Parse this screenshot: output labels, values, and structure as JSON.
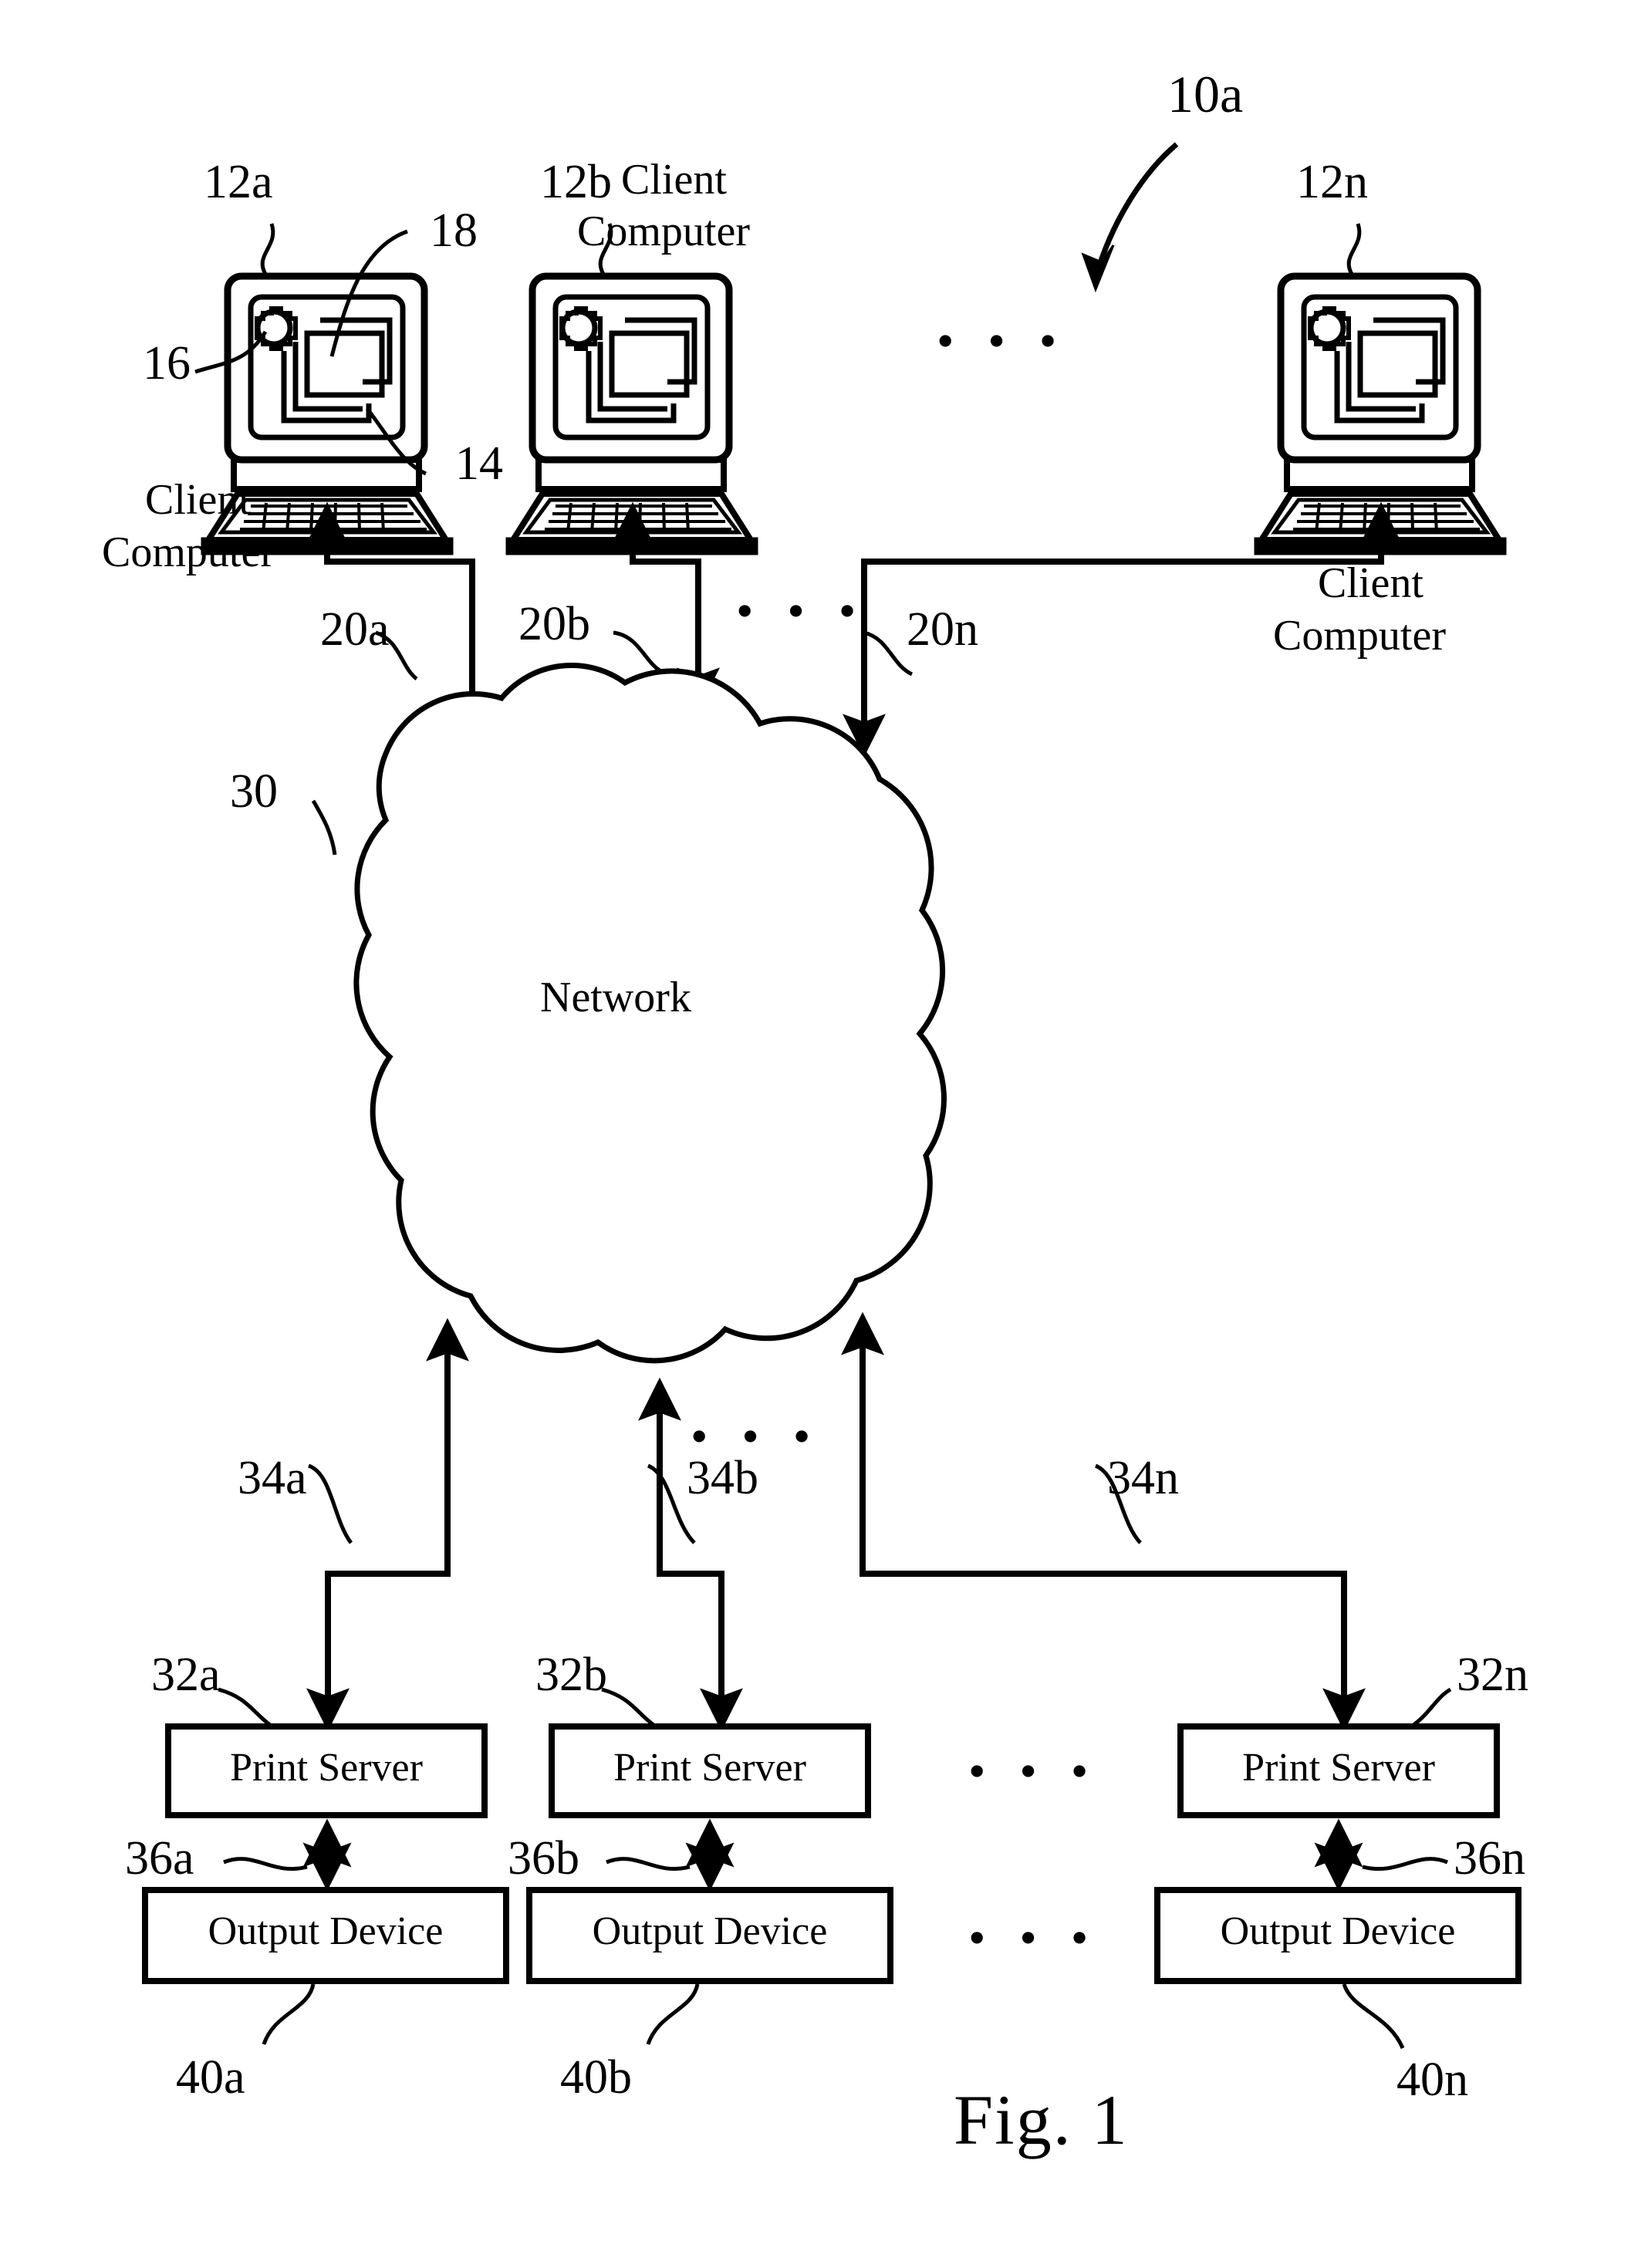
{
  "figure": {
    "caption": "Fig. 1",
    "system_ref": "10a"
  },
  "clients": [
    {
      "ref": "12a",
      "label_line1": "Client",
      "label_line2": "Computer",
      "link_ref": "20a",
      "sub_refs": [
        "18",
        "16",
        "14"
      ]
    },
    {
      "ref": "12b",
      "label_line1": "Client",
      "label_line2": "Computer",
      "link_ref": "20b"
    },
    {
      "ref": "12n",
      "label_line1": "Client",
      "label_line2": "Computer",
      "link_ref": "20n"
    }
  ],
  "client_detail_refs": {
    "display_ref": "18",
    "icon_ref": "16",
    "housing_ref": "14"
  },
  "network": {
    "label": "Network",
    "ref": "30"
  },
  "server_links": [
    "34a",
    "34b",
    "34n"
  ],
  "print_servers": [
    {
      "label": "Print Server",
      "ref": "32a"
    },
    {
      "label": "Print Server",
      "ref": "32b"
    },
    {
      "label": "Print Server",
      "ref": "32n"
    }
  ],
  "device_links": [
    "36a",
    "36b",
    "36n"
  ],
  "output_devices": [
    {
      "label": "Output Device",
      "ref": "40a"
    },
    {
      "label": "Output Device",
      "ref": "40b"
    },
    {
      "label": "Output Device",
      "ref": "40n"
    }
  ],
  "ellipses": {
    "clients_row": "• • •",
    "links_row": "• • •",
    "server_links_row": "• • •",
    "print_servers_row": "• • •",
    "output_devices_row": "• • •"
  },
  "colors": {
    "ink": "#000000",
    "paper": "#ffffff"
  }
}
